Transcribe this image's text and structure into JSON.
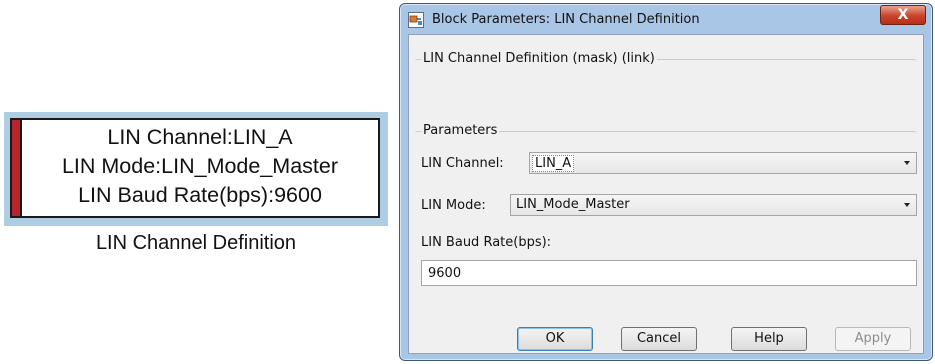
{
  "block": {
    "lines": [
      "LIN Channel:LIN_A",
      "LIN Mode:LIN_Mode_Master",
      "LIN Baud Rate(bps):9600"
    ],
    "caption": "LIN Channel Definition"
  },
  "dialog": {
    "title": "Block Parameters: LIN Channel Definition",
    "close_label": "X",
    "description_heading": "LIN Channel Definition (mask) (link)",
    "parameters_heading": "Parameters",
    "fields": {
      "channel": {
        "label": "LIN Channel:",
        "value": "LIN_A"
      },
      "mode": {
        "label": "LIN Mode:",
        "value": "LIN_Mode_Master"
      },
      "baud": {
        "label": "LIN Baud Rate(bps):",
        "value": "9600"
      }
    },
    "buttons": {
      "ok": "OK",
      "cancel": "Cancel",
      "help": "Help",
      "apply": "Apply"
    }
  },
  "colors": {
    "block_accent": "#b8262b",
    "block_highlight": "#aecde3",
    "window_frame": "#a9c6e6",
    "close_button": "#c9432b"
  },
  "icons": {
    "title": "simulink-block-icon",
    "close": "close-icon",
    "dropdown": "chevron-down-icon"
  }
}
